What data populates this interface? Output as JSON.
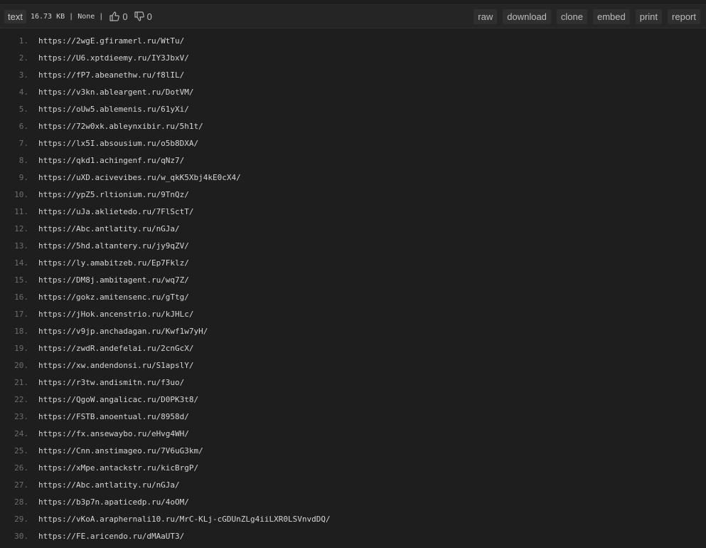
{
  "header": {
    "syntax_tag": "text",
    "meta": "16.73 KB | None |",
    "likes": "0",
    "dislikes": "0",
    "actions": [
      "raw",
      "download",
      "clone",
      "embed",
      "print",
      "report"
    ]
  },
  "lines": [
    "https://2wgE.gfiramerl.ru/WtTu/",
    "https://U6.xptdieemy.ru/IY3JbxV/",
    "https://fP7.abeanethw.ru/f8lIL/",
    "https://v3kn.ableargent.ru/DotVM/",
    "https://oUw5.ablemenis.ru/61yXi/",
    "https://72w0xk.ableynxibir.ru/5h1t/",
    "https://lx5I.absousium.ru/o5b8DXA/",
    "https://qkd1.achingenf.ru/qNz7/",
    "https://uXD.acivevibes.ru/w_qkK5Xbj4kE0cX4/",
    "https://ypZ5.rltionium.ru/9TnQz/",
    "https://uJa.aklietedo.ru/7FlSctT/",
    "https://Abc.antlatity.ru/nGJa/",
    "https://5hd.altantery.ru/jy9qZV/",
    "https://ly.amabitzeb.ru/Ep7Fklz/",
    "https://DM8j.ambitagent.ru/wq7Z/",
    "https://gokz.amitensenc.ru/gTtg/",
    "https://jHok.ancenstrio.ru/kJHLc/",
    "https://v9jp.anchadagan.ru/Kwf1w7yH/",
    "https://zwdR.andefelai.ru/2cnGcX/",
    "https://xw.andendonsi.ru/S1apslY/",
    "https://r3tw.andismitn.ru/f3uo/",
    "https://QgoW.angalicac.ru/D0PK3t8/",
    "https://FSTB.anoentual.ru/8958d/",
    "https://fx.ansewaybo.ru/eHvg4WH/",
    "https://Cnn.anstimageo.ru/7V6uG3km/",
    "https://xMpe.antackstr.ru/kicBrgP/",
    "https://Abc.antlatity.ru/nGJa/",
    "https://b3p7n.apaticedp.ru/4oOM/",
    "https://vKoA.araphernali10.ru/MrC-KLj-cGDUnZLg4iiLXR0LSVnvdDQ/",
    "https://FE.aricendo.ru/dMAaUT3/"
  ]
}
